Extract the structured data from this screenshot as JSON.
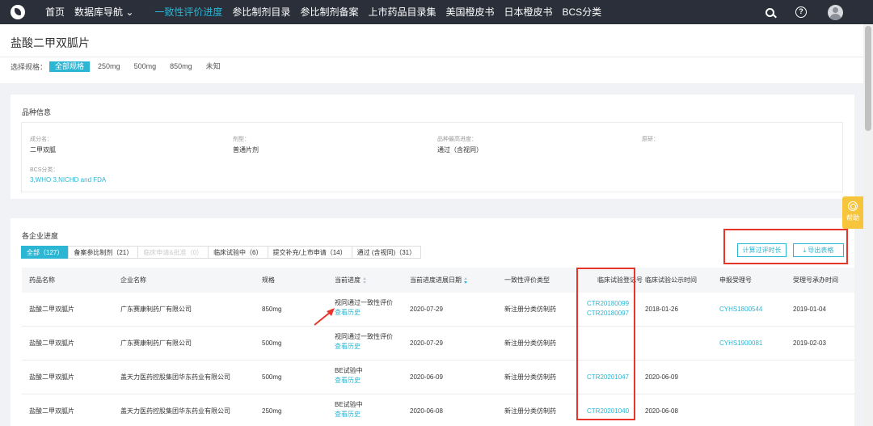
{
  "nav": {
    "logo_icon": "logo-icon",
    "items": [
      "首页",
      "数据库导航 ⌄",
      "一致性评价进度",
      "参比制剂目录",
      "参比制剂备案",
      "上市药品目录集",
      "美国橙皮书",
      "日本橙皮书",
      "BCS分类"
    ]
  },
  "page": {
    "title": "盐酸二甲双胍片",
    "spec_label": "选择规格：",
    "specs": [
      "全部规格",
      "250mg",
      "500mg",
      "850mg",
      "未知"
    ]
  },
  "variety": {
    "title": "品种信息",
    "fields": [
      {
        "label": "成分名：",
        "value": "二甲双胍"
      },
      {
        "label": "剂型：",
        "value": "普通片剂"
      },
      {
        "label": "品种最高进度：",
        "value": "通过（含视同）"
      },
      {
        "label": "原研：",
        "value": ""
      },
      {
        "label": "BCS分类：",
        "value": "3,WHO 3,NICHD and FDA"
      }
    ]
  },
  "progress": {
    "title": "各企业进度",
    "tabs": [
      "全部（127）",
      "备案参比制剂（21）",
      "临床申请&批准（0）",
      "临床试验中（6）",
      "提交补充/上市申请（14）",
      "通过 (含视同)（31）"
    ],
    "calc_button": "计算过评时长",
    "export_button": "导出表格",
    "columns": [
      "药品名称",
      "企业名称",
      "规格",
      "当前进度",
      "当前进度进展日期",
      "一致性评价类型",
      "临床试验登记号",
      "临床试验公示时间",
      "申报受理号",
      "受理号承办时间"
    ],
    "rows": [
      {
        "drug": "盐酸二甲双胍片",
        "company": "广东赛康制药厂有限公司",
        "spec": "850mg",
        "status": "视同通过一致性评价",
        "history": "查看历史",
        "date": "2020-07-29",
        "type": "新注册分类仿制药",
        "trials": [
          "CTR20180099",
          "CTR20180097"
        ],
        "trial_date": "2018-01-26",
        "accept_no": "CYHS1800544",
        "accept_date": "2019-01-04"
      },
      {
        "drug": "盐酸二甲双胍片",
        "company": "广东赛康制药厂有限公司",
        "spec": "500mg",
        "status": "视同通过一致性评价",
        "history": "查看历史",
        "date": "2020-07-29",
        "type": "新注册分类仿制药",
        "trials": [],
        "trial_date": "",
        "accept_no": "CYHS1900081",
        "accept_date": "2019-02-03"
      },
      {
        "drug": "盐酸二甲双胍片",
        "company": "盖天力医药控股集团华东药业有限公司",
        "spec": "500mg",
        "status": "BE试验中",
        "history": "查看历史",
        "date": "2020-06-09",
        "type": "新注册分类仿制药",
        "trials": [
          "CTR20201047"
        ],
        "trial_date": "2020-06-09",
        "accept_no": "",
        "accept_date": ""
      },
      {
        "drug": "盐酸二甲双胍片",
        "company": "盖天力医药控股集团华东药业有限公司",
        "spec": "250mg",
        "status": "BE试验中",
        "history": "查看历史",
        "date": "2020-06-08",
        "type": "新注册分类仿制药",
        "trials": [
          "CTR20201040"
        ],
        "trial_date": "2020-06-08",
        "accept_no": "",
        "accept_date": ""
      }
    ]
  },
  "help_label": "帮助",
  "colors": {
    "accent": "#2bb6d4",
    "nav_bg": "#2b2f3a",
    "highlight": "#e8352c"
  }
}
